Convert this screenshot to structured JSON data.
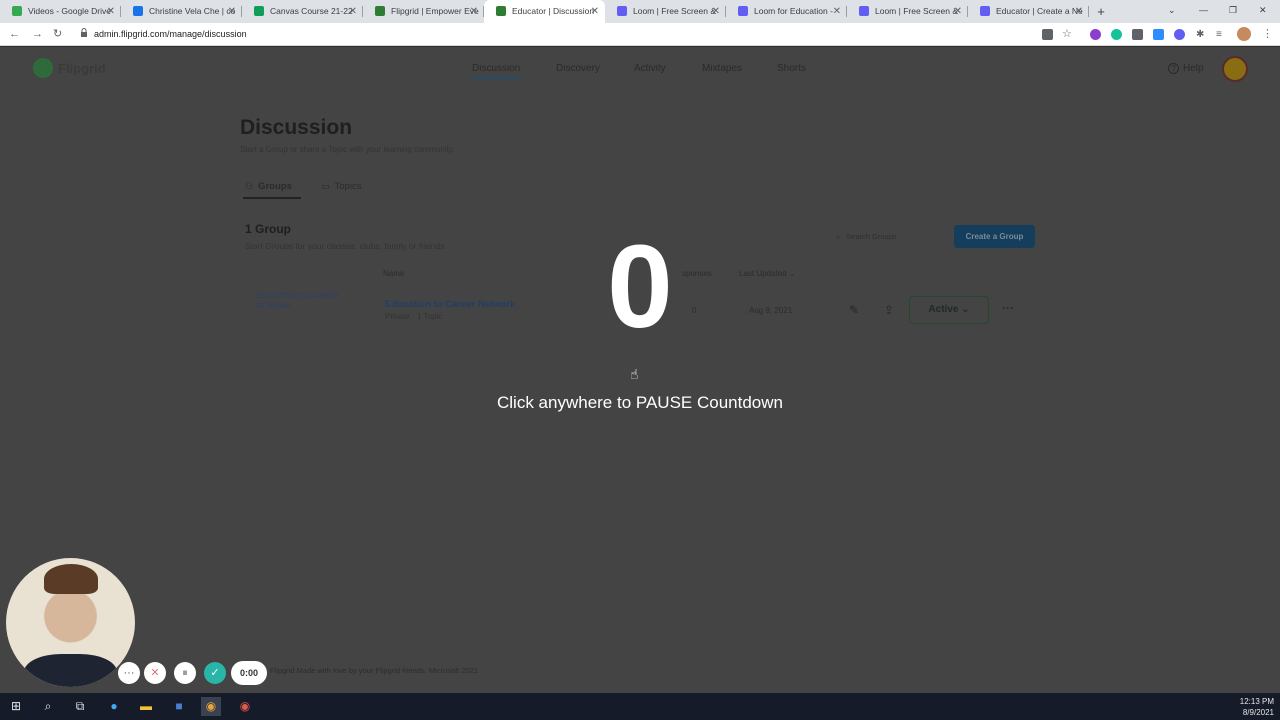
{
  "browser": {
    "tabs": [
      {
        "title": "Videos - Google Drive",
        "color": "#34a853"
      },
      {
        "title": "Christine Vela Che | co",
        "color": "#1a73e8"
      },
      {
        "title": "Canvas Course 21-22",
        "color": "#0f9d58"
      },
      {
        "title": "Flipgrid | Empower Eve",
        "color": "#2e7d32"
      },
      {
        "title": "Educator | Discussion",
        "color": "#2e7d32",
        "active": true
      },
      {
        "title": "Loom | Free Screen &",
        "color": "#625df5"
      },
      {
        "title": "Loom for Education - ",
        "color": "#625df5"
      },
      {
        "title": "Loom | Free Screen &",
        "color": "#625df5"
      },
      {
        "title": "Educator | Create a Ne",
        "color": "#625df5"
      }
    ],
    "new_tab": "+",
    "url": "admin.flipgrid.com/manage/discussion",
    "icons": {
      "back": "←",
      "forward": "→",
      "reload": "↻",
      "lock": "🔒",
      "minimize": "—",
      "restore": "❐",
      "close": "✕",
      "tab_close": "✕"
    }
  },
  "app": {
    "logo_text": "Flipgrid",
    "nav": [
      "Discussion",
      "Discovery",
      "Activity",
      "Mixtapes",
      "Shorts"
    ],
    "help": "Help"
  },
  "page": {
    "title": "Discussion",
    "subtitle": "Start a Group or share a Topic with your learning community.",
    "tabs": [
      "Groups",
      "Topics"
    ],
    "groups_count": "1 Group",
    "groups_subtitle": "Start Groups for your classes, clubs, family or friends.",
    "search_placeholder": "Search Groups",
    "create_button": "Create a Group",
    "columns": {
      "name": "Name",
      "responses": "sponses",
      "updated": "Last Updated"
    },
    "group": {
      "logo_text": "EDUCATION TO CAREER NETWORK",
      "name": "Education to Career Network",
      "meta": "Private · 1 Topic",
      "responses": "0",
      "updated": "Aug 9, 2021",
      "status": "Active"
    },
    "footer": "Flipgrid    Made with love by your Flipgrid friends.    Microsoft 2021"
  },
  "overlay": {
    "countdown": "0",
    "hint": "Click anywhere to PAUSE Countdown"
  },
  "recorder": {
    "timer": "0:00"
  },
  "taskbar": {
    "time": "12:13 PM",
    "date": "8/9/2021"
  }
}
